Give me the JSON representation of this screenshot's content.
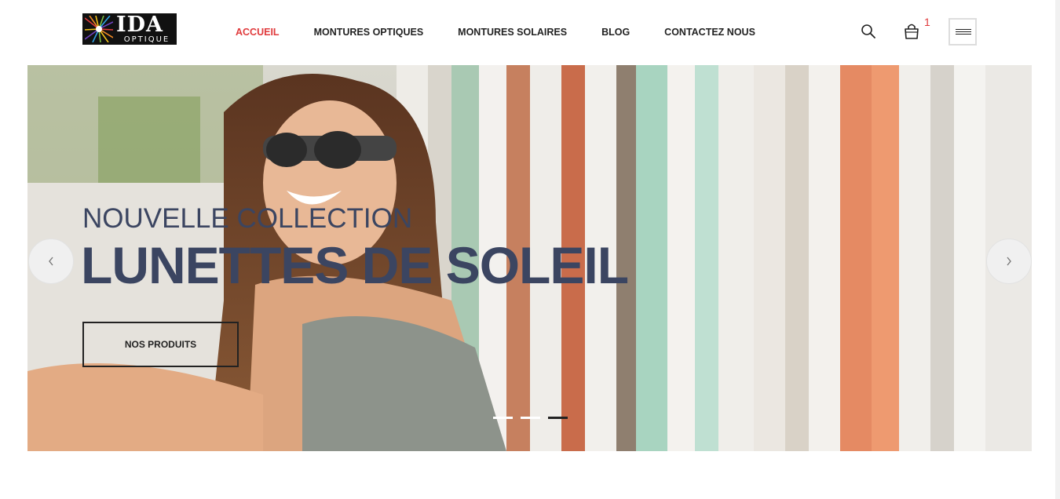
{
  "logo": {
    "top_text": "IDA",
    "bottom_text": "OPTIQUE"
  },
  "nav": {
    "items": [
      {
        "label": "ACCUEIL",
        "active": true
      },
      {
        "label": "MONTURES OPTIQUES",
        "active": false
      },
      {
        "label": "MONTURES SOLAIRES",
        "active": false
      },
      {
        "label": "BLOG",
        "active": false
      },
      {
        "label": "CONTACTEZ NOUS",
        "active": false
      }
    ]
  },
  "header_icons": {
    "search": "search-icon",
    "cart": "cart-icon",
    "menu": "hamburger-menu-icon",
    "cart_count": "1"
  },
  "hero": {
    "eyebrow": "NOUVELLE COLLECTION",
    "title": "LUNETTES DE SOLEIL",
    "button_label": "NOS PRODUITS",
    "slides_total": 3,
    "active_slide": 3
  },
  "colors": {
    "accent": "#e03a3c",
    "hero_text": "#3b4561",
    "text": "#222222"
  }
}
